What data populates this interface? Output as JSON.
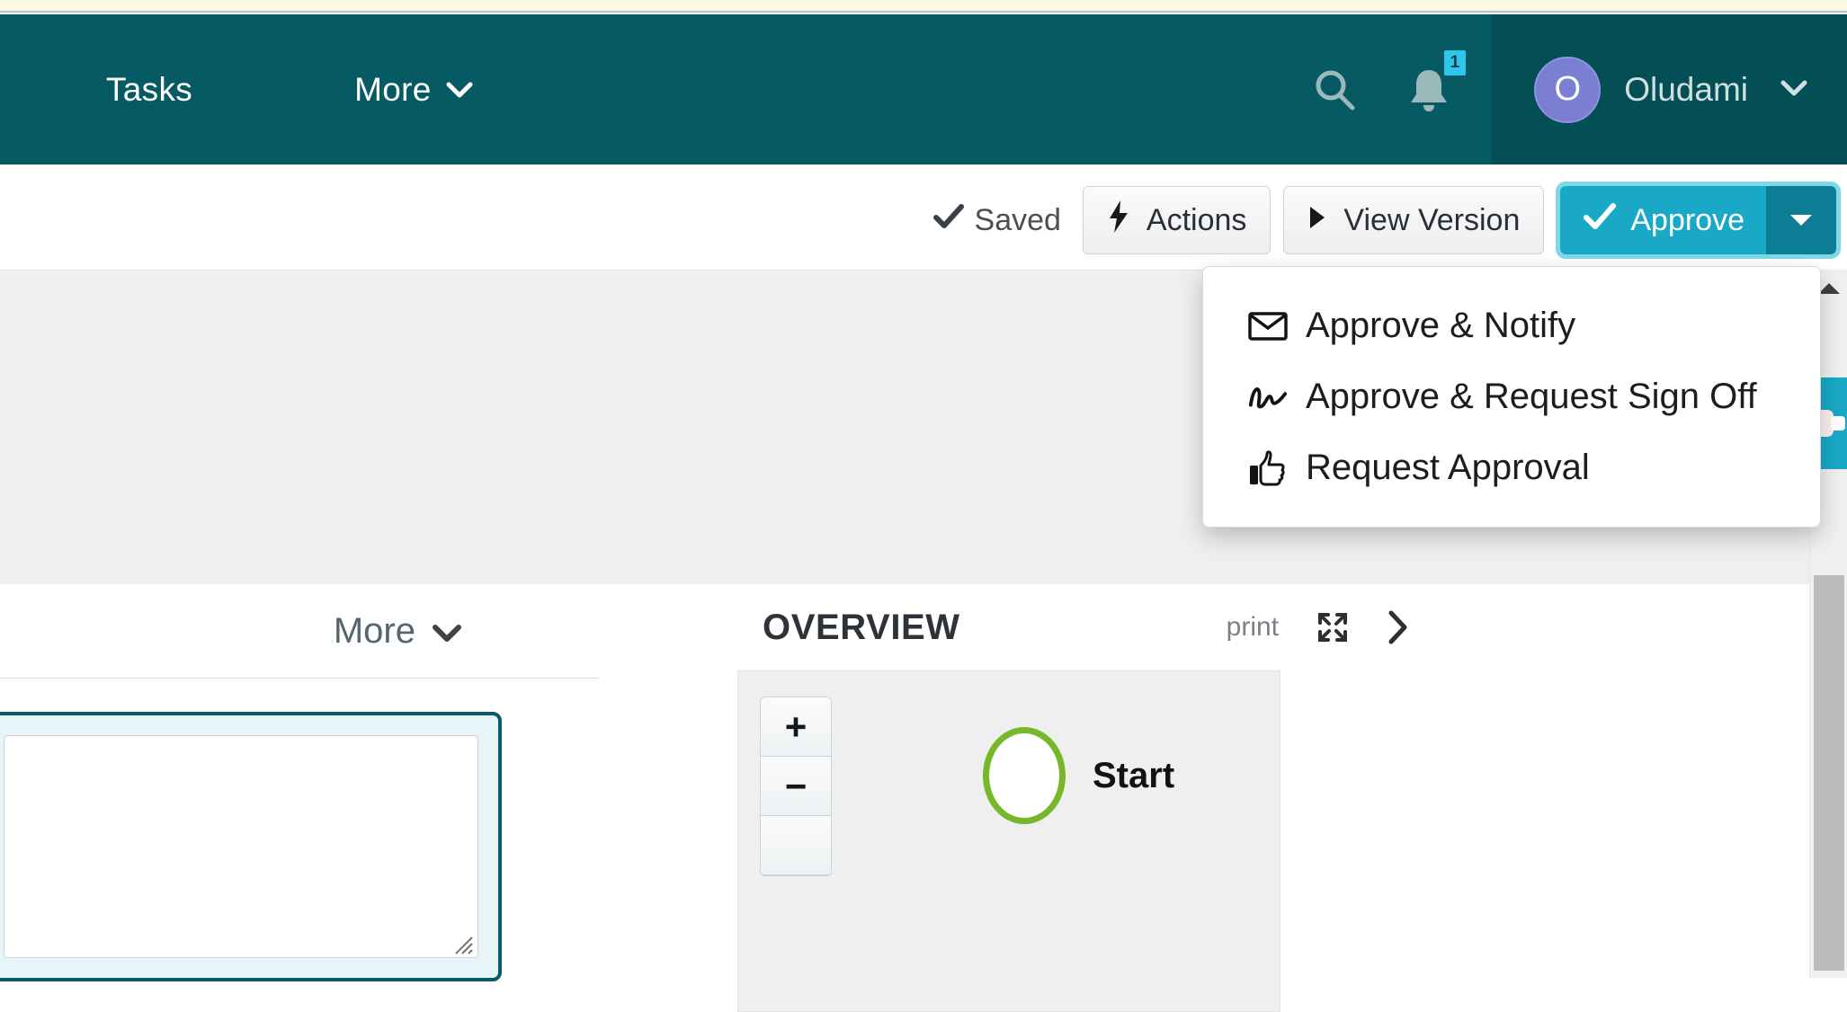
{
  "header": {
    "nav": [
      {
        "label": "Tasks",
        "has_caret": false
      },
      {
        "label": "More",
        "has_caret": true,
        "caret": "⌄"
      }
    ],
    "search_icon": "search-icon",
    "notifications": {
      "icon": "bell-icon",
      "badge_count": "1"
    },
    "user": {
      "avatar_initial": "O",
      "name": "Oludami",
      "caret": "⌄"
    }
  },
  "toolbar": {
    "saved_label": "Saved",
    "saved_check": "✔",
    "actions_label": "Actions",
    "actions_icon": "bolt-icon",
    "view_version_label": "View Version",
    "view_version_icon": "play-triangle-icon",
    "approve_label": "Approve",
    "approve_check": "✔",
    "approve_caret": "▾",
    "approve_color": "#19a9c6",
    "approve_caret_color": "#0c7d94",
    "focus_ring_color": "#7fd8e8"
  },
  "approve_menu": {
    "open": true,
    "items": [
      {
        "label": "Approve & Notify",
        "icon": "envelope-icon"
      },
      {
        "label": "Approve & Request Sign Off",
        "icon": "signature-icon"
      },
      {
        "label": "Request Approval",
        "icon": "thumbs-up-icon"
      }
    ]
  },
  "left_panel": {
    "more_label": "More",
    "more_caret": "⌄",
    "editor_placeholder": ""
  },
  "overview": {
    "title": "OVERVIEW",
    "print_label": "print",
    "expand_icon": "expand-arrows-icon",
    "next_icon": "chevron-right-icon",
    "zoom_in": "+",
    "zoom_out": "−",
    "nodes": [
      {
        "label": "Start",
        "shape": "circle",
        "color": "#76b82a"
      }
    ]
  },
  "scrollbar": {
    "up_arrow": "▲",
    "thumb_color": "#bcbcbc"
  },
  "side_tab": {
    "name": "feedback-tab",
    "color": "#19a9c6"
  },
  "theme": {
    "header_bg": "#065a63",
    "header_user_bg": "#044e55",
    "top_strip": "#fdf8e3",
    "content_gray": "#efefef",
    "avatar_bg": "#7b7fd4",
    "badge_bg": "#2ec6ea"
  }
}
